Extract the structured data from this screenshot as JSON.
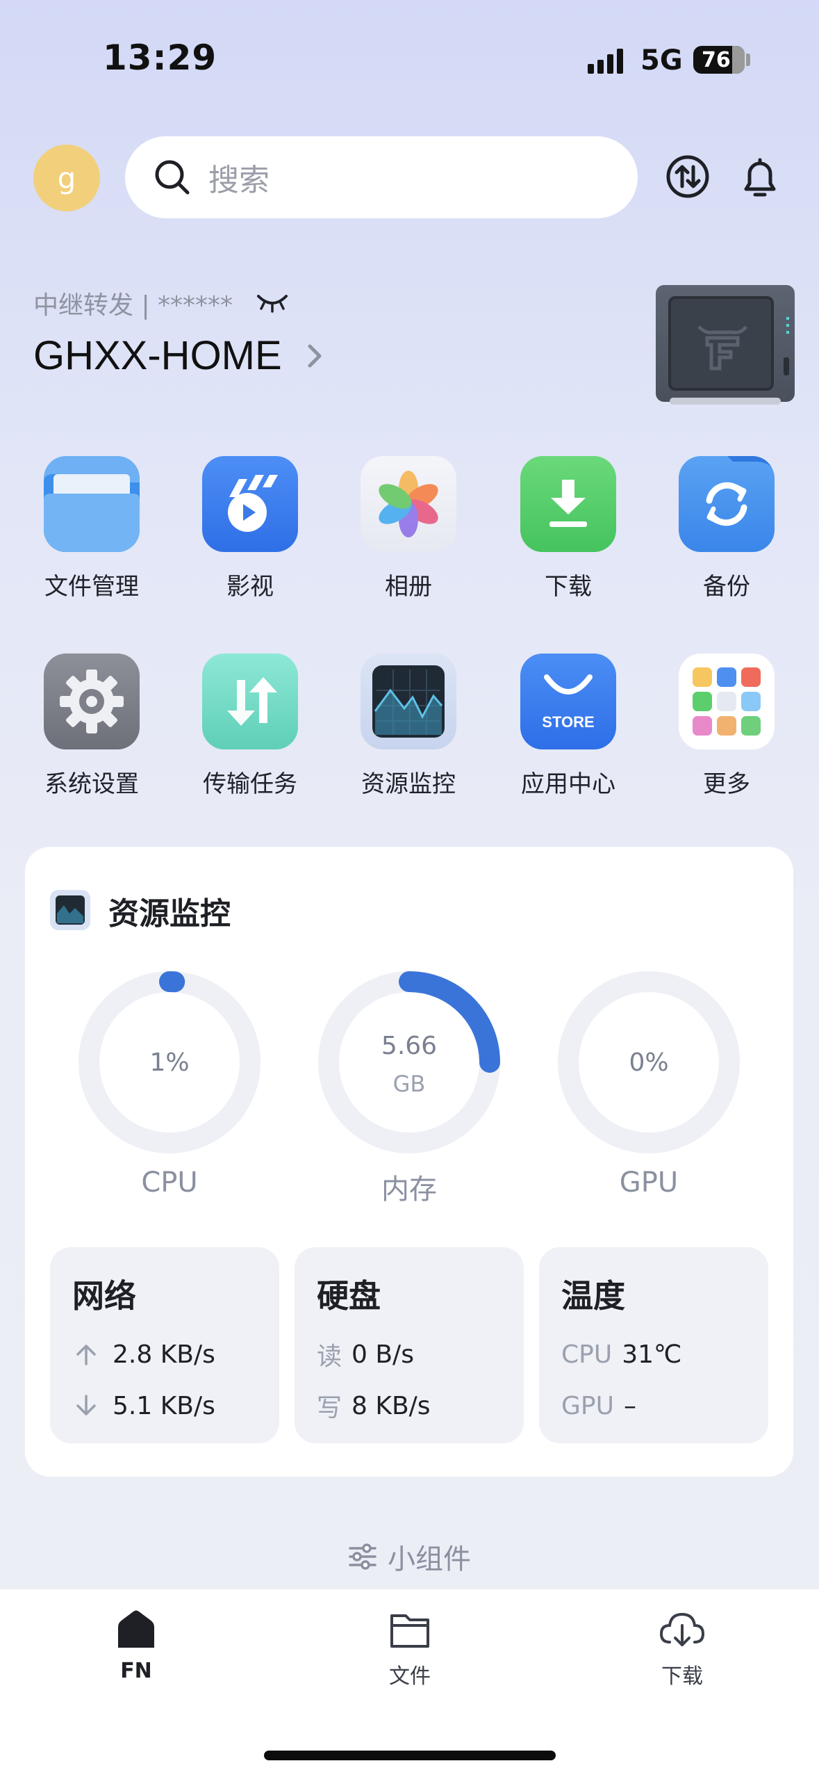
{
  "status_bar": {
    "time": "13:29",
    "network": "5G",
    "battery": "76"
  },
  "header": {
    "avatar_letter": "g",
    "search_placeholder": "搜索"
  },
  "device": {
    "relay_text": "中继转发 | ******",
    "name": "GHXX-HOME"
  },
  "apps": [
    {
      "label": "文件管理",
      "icon": "folder-icon"
    },
    {
      "label": "影视",
      "icon": "video-icon"
    },
    {
      "label": "相册",
      "icon": "photos-icon"
    },
    {
      "label": "下载",
      "icon": "download-icon"
    },
    {
      "label": "备份",
      "icon": "backup-icon"
    },
    {
      "label": "系统设置",
      "icon": "settings-icon"
    },
    {
      "label": "传输任务",
      "icon": "transfer-icon"
    },
    {
      "label": "资源监控",
      "icon": "monitor-icon"
    },
    {
      "label": "应用中心",
      "icon": "store-icon"
    },
    {
      "label": "更多",
      "icon": "more-apps-icon"
    }
  ],
  "store_badge": "STORE",
  "monitor": {
    "title": "资源监控",
    "gauges": [
      {
        "label": "CPU",
        "value": "1%",
        "unit": "",
        "fraction": 0.01
      },
      {
        "label": "内存",
        "value": "5.66",
        "unit": "GB",
        "fraction": 0.25
      },
      {
        "label": "GPU",
        "value": "0%",
        "unit": "",
        "fraction": 0
      }
    ],
    "network": {
      "title": "网络",
      "up": "2.8 KB/s",
      "down": "5.1 KB/s"
    },
    "disk": {
      "title": "硬盘",
      "read_label": "读",
      "read": "0 B/s",
      "write_label": "写",
      "write": "8 KB/s"
    },
    "temperature": {
      "title": "温度",
      "cpu_label": "CPU",
      "cpu": "31℃",
      "gpu_label": "GPU",
      "gpu": "–"
    }
  },
  "widgets_label": "小组件",
  "tabs": [
    {
      "label": "FN"
    },
    {
      "label": "文件"
    },
    {
      "label": "下载"
    }
  ],
  "colors": {
    "accent": "#3b74d9",
    "track": "#eef0f5",
    "card": "#ffffff"
  }
}
